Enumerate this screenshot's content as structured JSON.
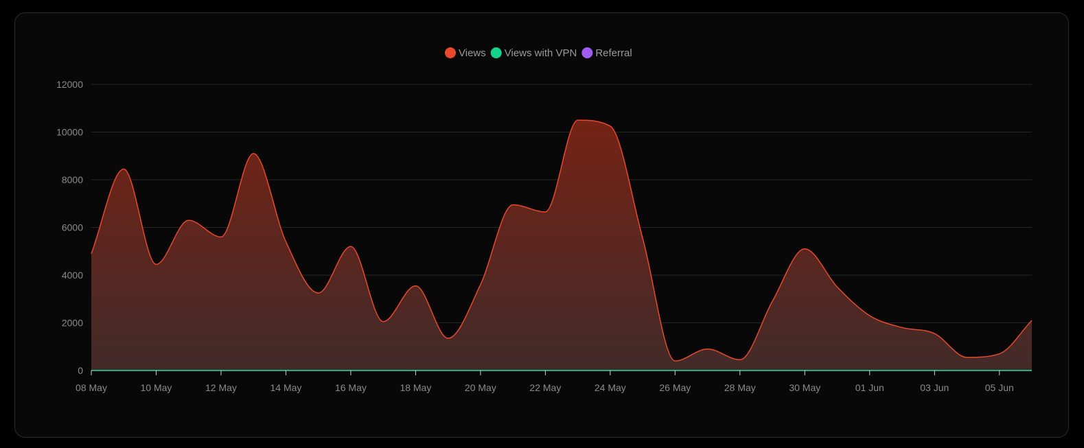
{
  "chart_data": {
    "type": "area",
    "x": [
      "08 May",
      "09 May",
      "10 May",
      "11 May",
      "12 May",
      "13 May",
      "14 May",
      "15 May",
      "16 May",
      "17 May",
      "18 May",
      "19 May",
      "20 May",
      "21 May",
      "22 May",
      "23 May",
      "24 May",
      "25 May",
      "26 May",
      "27 May",
      "28 May",
      "29 May",
      "30 May",
      "31 May",
      "01 Jun",
      "02 Jun",
      "03 Jun",
      "04 Jun",
      "05 Jun",
      "06 Jun"
    ],
    "x_tick_labels": [
      "08 May",
      "10 May",
      "12 May",
      "14 May",
      "16 May",
      "18 May",
      "20 May",
      "22 May",
      "24 May",
      "26 May",
      "28 May",
      "30 May",
      "01 Jun",
      "03 Jun",
      "05 Jun"
    ],
    "ylim": [
      0,
      12000
    ],
    "y_ticks": [
      "0",
      "2000",
      "4000",
      "6000",
      "8000",
      "10000",
      "12000"
    ],
    "grid": true,
    "legend_position": "top-center",
    "series": [
      {
        "name": "Views",
        "color": "#e8482c",
        "values": [
          4900,
          8450,
          4450,
          6300,
          5600,
          9100,
          5400,
          3250,
          5200,
          2050,
          3550,
          1350,
          3600,
          6950,
          6650,
          10500,
          10250,
          5550,
          400,
          900,
          450,
          2900,
          5100,
          3500,
          2300,
          1800,
          1550,
          550,
          700,
          2100
        ]
      },
      {
        "name": "Views with VPN",
        "color": "#14d38a",
        "values": [
          0,
          0,
          0,
          0,
          0,
          0,
          0,
          0,
          0,
          0,
          0,
          0,
          0,
          0,
          0,
          0,
          0,
          0,
          0,
          0,
          0,
          0,
          0,
          0,
          0,
          0,
          0,
          0,
          0,
          0
        ]
      },
      {
        "name": "Referral",
        "color": "#a05cf0",
        "values": [
          0,
          0,
          0,
          0,
          0,
          0,
          0,
          0,
          0,
          0,
          0,
          0,
          0,
          0,
          0,
          0,
          0,
          0,
          0,
          0,
          0,
          0,
          0,
          0,
          0,
          0,
          0,
          0,
          0,
          0
        ]
      }
    ]
  }
}
